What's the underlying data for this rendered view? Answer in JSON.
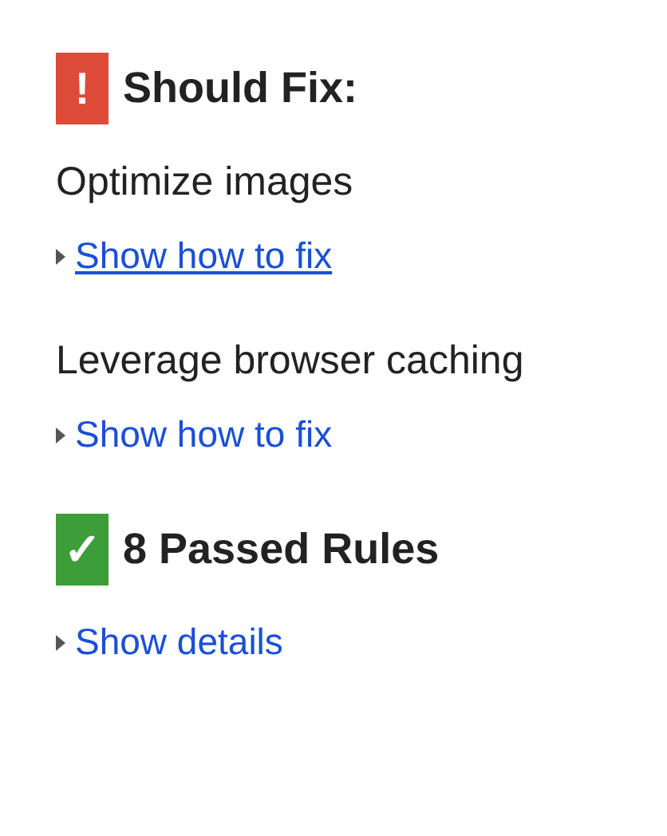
{
  "sections": [
    {
      "kind": "should_fix",
      "icon": "!",
      "title": "Should Fix:",
      "rules": [
        {
          "name": "Optimize images",
          "link": {
            "label": "Show how to fix",
            "hovered": true
          }
        },
        {
          "name": "Leverage browser caching",
          "link": {
            "label": "Show how to fix",
            "hovered": false
          }
        }
      ]
    },
    {
      "kind": "passed",
      "icon": "✓",
      "title": "8 Passed Rules",
      "link": {
        "label": "Show details",
        "hovered": false
      }
    }
  ]
}
